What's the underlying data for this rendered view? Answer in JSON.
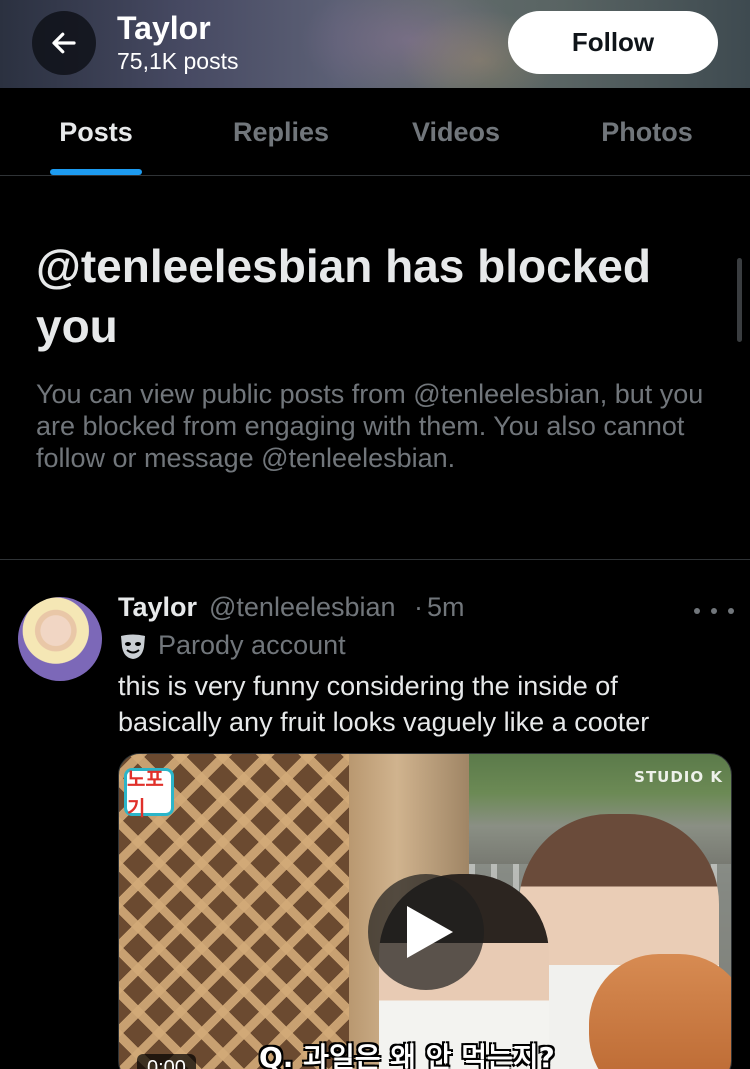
{
  "header": {
    "name": "Taylor",
    "post_count": "75,1K posts",
    "follow_label": "Follow"
  },
  "tabs": [
    {
      "label": "Posts",
      "active": true
    },
    {
      "label": "Replies",
      "active": false
    },
    {
      "label": "Videos",
      "active": false
    },
    {
      "label": "Photos",
      "active": false
    }
  ],
  "blocked_notice": {
    "title": "@tenleelesbian has blocked you",
    "description": "You can view public posts from @tenleelesbian, but you are blocked from engaging with them. You also cannot follow or message @tenleelesbian."
  },
  "tweet": {
    "display_name": "Taylor",
    "handle": "@tenleelesbian",
    "separator": "·",
    "time": "5m",
    "account_label": "Parody account",
    "text": "this is very funny considering the inside of basically any fruit looks vaguely like a cooter",
    "media": {
      "type": "video",
      "badge": "노포기",
      "watermark": "STUDIO K",
      "subtitle": "Q. 과일은 왜 안 먹는지?",
      "duration": "0:00"
    }
  },
  "colors": {
    "background": "#000000",
    "accent": "#1d9bf0",
    "secondary_text": "#71767b",
    "primary_text": "#e7e9ea",
    "divider": "#2f3336"
  },
  "icons": {
    "back": "arrow-left-icon",
    "more": "more-horizontal-icon",
    "parody": "theater-mask-icon",
    "play": "play-icon"
  }
}
